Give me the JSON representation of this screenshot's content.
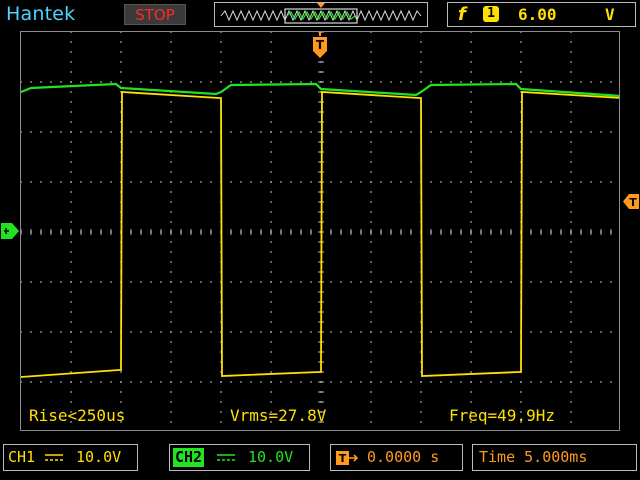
{
  "header": {
    "brand": "Hantek",
    "run_state": "STOP",
    "trigger": {
      "edge_symbol": "f",
      "source": "1",
      "level": "6.00",
      "unit": "V"
    }
  },
  "screen": {
    "trigger_marker": "T",
    "measurements": {
      "rise": "Rise<250us",
      "vrms": "Vrms=27.8V",
      "freq": "Freq=49.9Hz"
    }
  },
  "footer": {
    "ch1": {
      "label": "CH1",
      "coupling": "⎓",
      "scale": "10.0V"
    },
    "ch2": {
      "label": "CH2",
      "coupling": "⎓",
      "scale": "10.0V"
    },
    "trigger_position": "0.0000 s",
    "trigger_position_icon": "T",
    "timebase": "Time 5.000ms"
  },
  "colors": {
    "ch1": "#ffe000",
    "ch2": "#22e222",
    "accent": "#ff9a1f",
    "brand": "#4fd3ff",
    "stop": "#ff2a2a"
  },
  "icons": {
    "trigger_edge": "rising-edge-icon",
    "trigger_marker": "trigger-position-icon",
    "ch1_ground_marker": "ch1-ground-marker-icon",
    "trigger_level_marker": "trigger-level-marker-icon"
  }
}
